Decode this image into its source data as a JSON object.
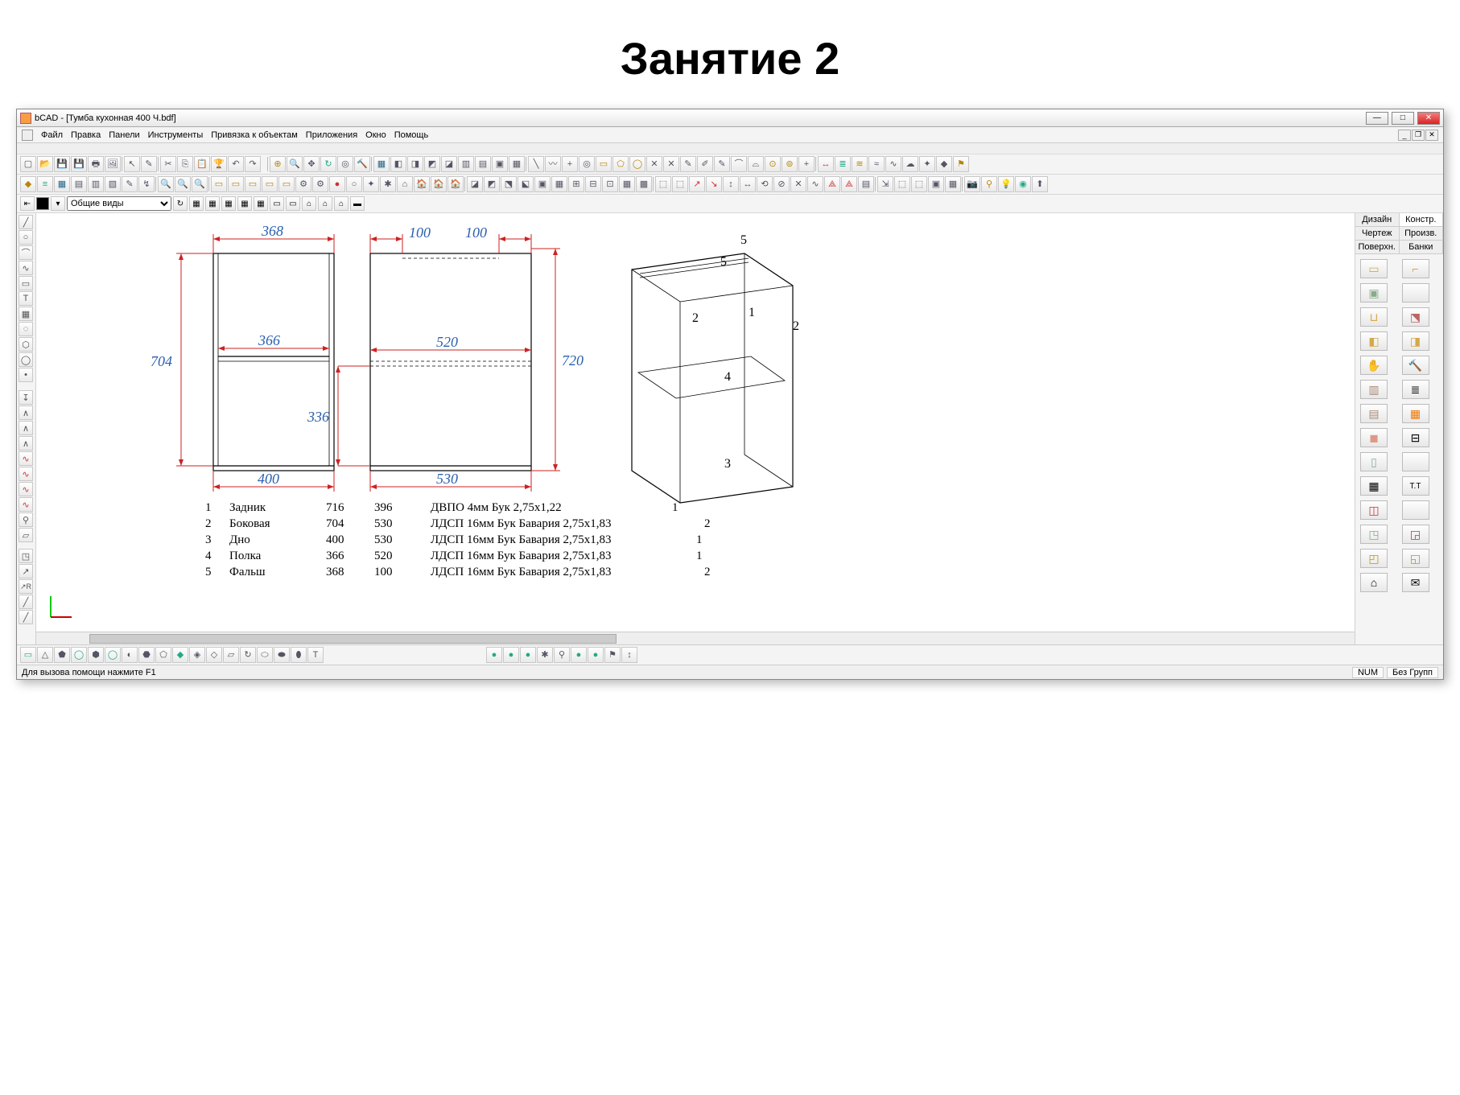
{
  "page_title": "Занятие 2",
  "window": {
    "title": "bCAD - [Тумба кухонная 400 Ч.bdf]",
    "btn_min": "—",
    "btn_max": "□",
    "btn_close": "✕"
  },
  "menu": [
    "Файл",
    "Правка",
    "Панели",
    "Инструменты",
    "Привязка к объектам",
    "Приложения",
    "Окно",
    "Помощь"
  ],
  "layerbar": {
    "dropdown": "Общие виды"
  },
  "right_tabs_row1": [
    "Дизайн",
    "Констр."
  ],
  "right_tabs_row2": [
    "Чертеж",
    "Произв."
  ],
  "right_tabs_row3": [
    "Поверхн.",
    "Банки"
  ],
  "dimensions": {
    "d368": "368",
    "d366": "366",
    "d400": "400",
    "d704": "704",
    "d100a": "100",
    "d100b": "100",
    "d520": "520",
    "d530": "530",
    "d336": "336",
    "d720": "720"
  },
  "iso_labels": {
    "p1": "1",
    "p2": "2",
    "p2b": "2",
    "p3": "3",
    "p4": "4",
    "p5": "5",
    "p5b": "5"
  },
  "spec_rows": [
    {
      "n": "1",
      "name": "Задник",
      "a": "716",
      "b": "396",
      "mat": "ДВПО 4мм Бук 2,75x1,22",
      "qty": "1"
    },
    {
      "n": "2",
      "name": "Боковая",
      "a": "704",
      "b": "530",
      "mat": "ЛДСП 16мм Бук Бавария 2,75x1,83",
      "qty": "2"
    },
    {
      "n": "3",
      "name": "Дно",
      "a": "400",
      "b": "530",
      "mat": "ЛДСП 16мм Бук Бавария 2,75x1,83",
      "qty": "1"
    },
    {
      "n": "4",
      "name": "Полка",
      "a": "366",
      "b": "520",
      "mat": "ЛДСП 16мм Бук Бавария 2,75x1,83",
      "qty": "1"
    },
    {
      "n": "5",
      "name": "Фальш",
      "a": "368",
      "b": "100",
      "mat": "ЛДСП 16мм Бук Бавария 2,75x1,83",
      "qty": "2"
    }
  ],
  "statusbar": {
    "help": "Для вызова помощи нажмите F1",
    "num": "NUM",
    "group": "Без Групп"
  }
}
